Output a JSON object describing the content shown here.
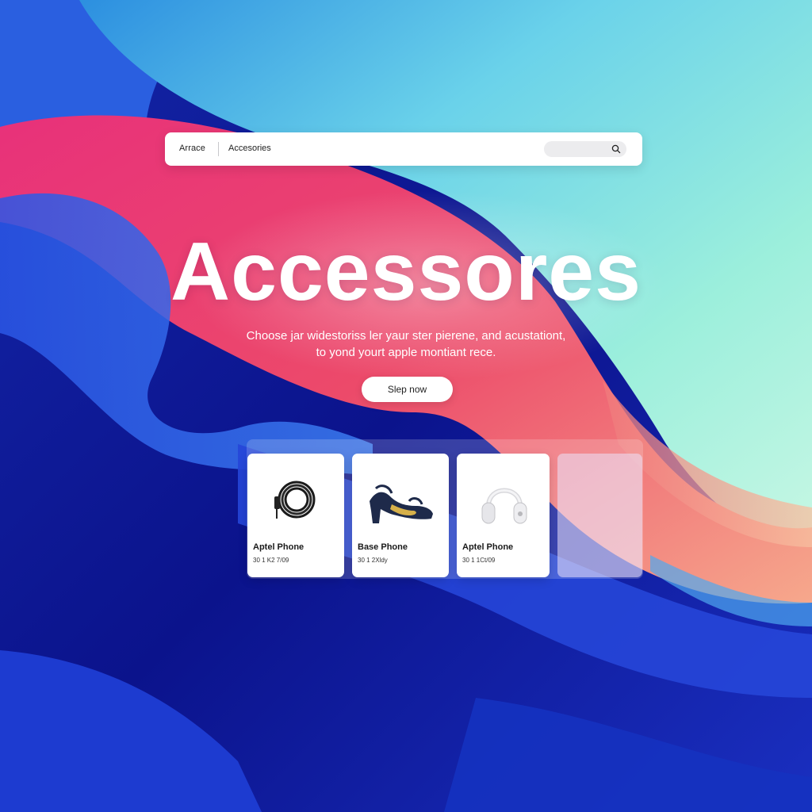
{
  "nav": {
    "brand": "Arrace",
    "link": "Accesories"
  },
  "hero": {
    "title": "Accessores",
    "subtitle_line1": "Choose jar widestoriss ler yaur ster pierene, and acustationt,",
    "subtitle_line2": "to yond yourt apple montiant rece.",
    "cta_label": "Slep now"
  },
  "products": [
    {
      "name": "Aptel Phone",
      "meta": "30 1 K2 7/09",
      "icon": "cable-coil-icon"
    },
    {
      "name": "Base Phone",
      "meta": "30 1 2Xldy",
      "icon": "sandal-icon"
    },
    {
      "name": "Aptel Phone",
      "meta": "30 1 1Ct/09",
      "icon": "headphones-icon"
    }
  ],
  "colors": {
    "deep_blue": "#0a1590",
    "royal_blue": "#2a4fe0",
    "pink": "#ef4a78",
    "coral": "#f5a38c",
    "mint": "#9ff0d6",
    "cyan": "#3fb5e8"
  }
}
